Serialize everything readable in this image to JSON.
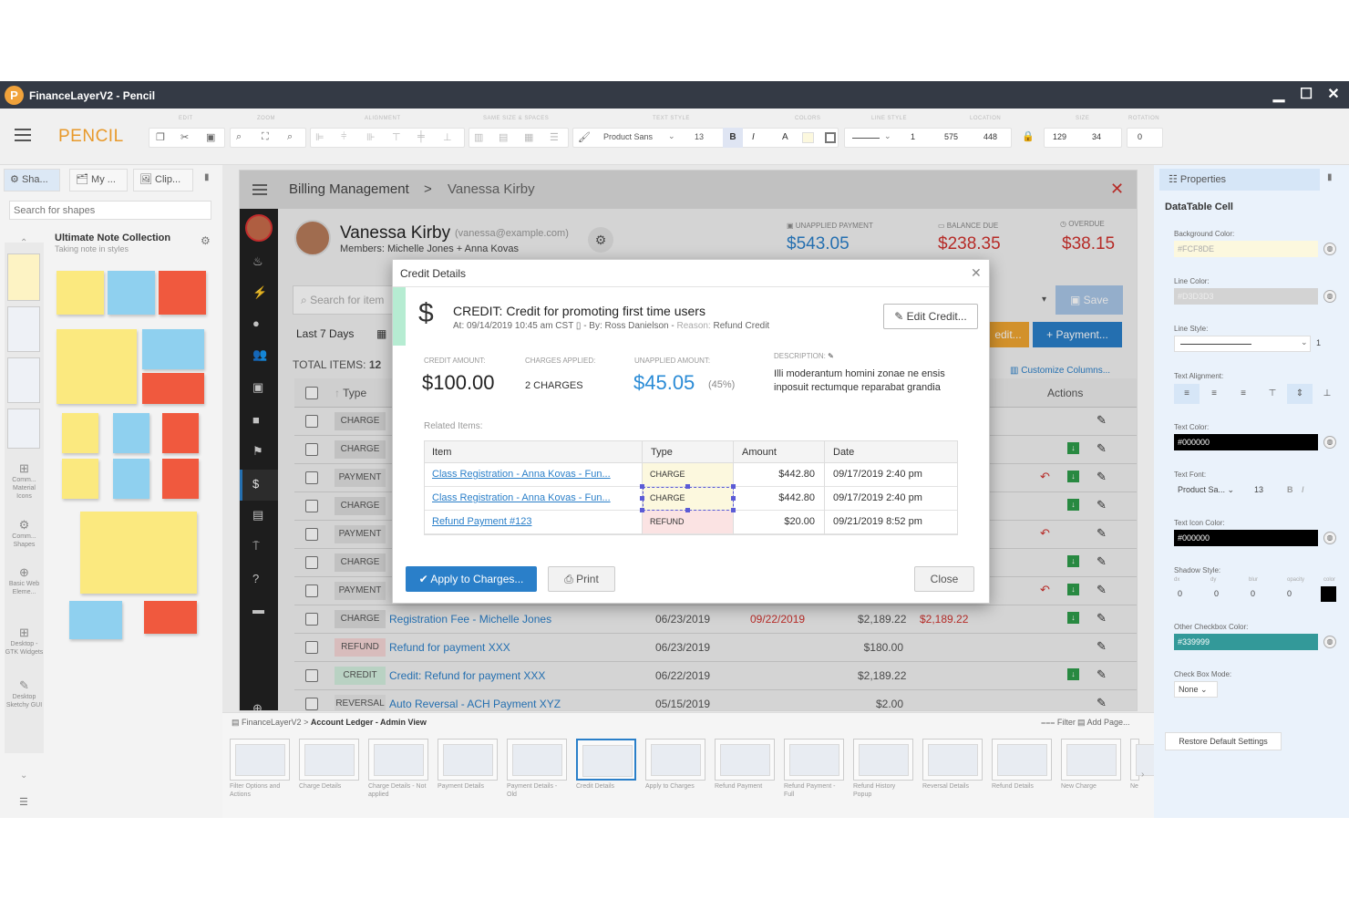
{
  "app": {
    "title": "FinanceLayerV2 - Pencil",
    "logo_letter": "P",
    "brand": "PENCIL",
    "brand_color": "#e8992a"
  },
  "window_controls": {
    "minimize": "▁",
    "maximize": "☐",
    "close": "✕"
  },
  "toolbar": {
    "section_labels": [
      "EDIT",
      "ZOOM",
      "ALIGNMENT",
      "SAME SIZE & SPACES",
      "TEXT STYLE",
      "COLORS",
      "LINE STYLE",
      "LOCATION",
      "SIZE",
      "ROTATION"
    ],
    "font_name": "Product Sans",
    "font_size": "13",
    "bold": "B",
    "italic": "I",
    "text_color": "A",
    "line_width": "1",
    "loc_x": "575",
    "loc_y": "448",
    "width": "129",
    "height": "34",
    "rotation": "0"
  },
  "left": {
    "tabs": [
      "Sha...",
      "My ...",
      "Clip..."
    ],
    "search_placeholder": "Search for shapes",
    "collection_title": "Ultimate Note Collection",
    "collection_subtitle": "Taking note in styles",
    "rail": [
      "Comm... Material Icons",
      "Comm... Shapes",
      "Basic Web Eleme...",
      "Desktop - GTK Widgets",
      "Desktop Sketchy GUI"
    ]
  },
  "page": {
    "breadcrumb_root": "Billing Management",
    "breadcrumb_sep": ">",
    "breadcrumb_leaf": "Vanessa Kirby",
    "customer": {
      "name": "Vanessa Kirby",
      "email": "(vanessa@example.com)",
      "members": "Members: Michelle Jones + Anna Kovas"
    },
    "stats": [
      {
        "label": "UNAPPLIED PAYMENT",
        "value": "$543.05",
        "color": "#2a7fc9"
      },
      {
        "label": "BALANCE DUE",
        "value": "$238.35",
        "color": "#d0312d"
      },
      {
        "label": "OVERDUE",
        "value": "$38.15",
        "color": "#d0312d"
      }
    ],
    "search_placeholder": "Search for item",
    "date_filter": "Last 7 Days",
    "total_items_label": "TOTAL ITEMS:",
    "total_items": "12",
    "save_label": "Save",
    "credit_label": "edit...",
    "payment_label": "+ Payment...",
    "customize_label": "Customize Columns...",
    "col_type": "Type",
    "col_actions": "Actions",
    "rows": [
      {
        "type": "CHARGE",
        "item": "",
        "date": "",
        "due": "",
        "amount": "",
        "balance": ""
      },
      {
        "type": "CHARGE",
        "item": "",
        "date": "",
        "due": "",
        "amount": "",
        "balance": ""
      },
      {
        "type": "PAYMENT",
        "item": "",
        "date": "",
        "due": "",
        "amount": "",
        "balance": ""
      },
      {
        "type": "CHARGE",
        "item": "",
        "date": "",
        "due": "",
        "amount": "",
        "balance": ""
      },
      {
        "type": "PAYMENT",
        "item": "",
        "date": "",
        "due": "",
        "amount": "",
        "balance": ""
      },
      {
        "type": "CHARGE",
        "item": "",
        "date": "",
        "due": "",
        "amount": "",
        "balance": ""
      },
      {
        "type": "PAYMENT",
        "item": "",
        "date": "",
        "due": "",
        "amount": "",
        "balance": ""
      },
      {
        "type": "CHARGE",
        "item": "Registration Fee - Michelle Jones",
        "date": "06/23/2019",
        "due": "09/22/2019",
        "amount": "$2,189.22",
        "balance": "$2,189.22"
      },
      {
        "type": "REFUND",
        "item": "Refund for payment XXX",
        "date": "06/23/2019",
        "due": "",
        "amount": "$180.00",
        "balance": ""
      },
      {
        "type": "CREDIT",
        "item": "Credit: Refund for payment XXX",
        "date": "06/22/2019",
        "due": "",
        "amount": "$2,189.22",
        "balance": ""
      },
      {
        "type": "REVERSAL",
        "item": "Auto Reversal - ACH Payment XYZ",
        "date": "05/15/2019",
        "due": "",
        "amount": "$2.00",
        "balance": ""
      }
    ]
  },
  "modal": {
    "title": "Credit Details",
    "heading": "CREDIT: Credit for promoting first time users",
    "meta": "At: 09/14/2019 10:45 am CST",
    "by": "- By: Ross Danielson -",
    "reason_label": "Reason:",
    "reason": "Refund Credit",
    "edit_label": "Edit Credit...",
    "credit_amount_label": "CREDIT AMOUNT:",
    "credit_amount": "$100.00",
    "charges_applied_label": "CHARGES APPLIED:",
    "charges_applied": "2 CHARGES",
    "unapplied_label": "UNAPPLIED AMOUNT:",
    "unapplied": "$45.05",
    "unapplied_pct": "(45%)",
    "description_label": "DESCRIPTION:",
    "description": "Illi moderantum homini zonae ne ensis inposuit rectumque reparabat grandia",
    "related_label": "Related Items:",
    "cols": [
      "Item",
      "Type",
      "Amount",
      "Date"
    ],
    "items": [
      {
        "item": "Class Registration - Anna Kovas - Fun...",
        "type": "CHARGE",
        "amount": "$442.80",
        "date": "09/17/2019 2:40 pm"
      },
      {
        "item": "Class Registration - Anna Kovas - Fun...",
        "type": "CHARGE",
        "amount": "$442.80",
        "date": "09/17/2019 2:40 pm"
      },
      {
        "item": "Refund Payment #123",
        "type": "REFUND",
        "amount": "$20.00",
        "date": "09/21/2019 8:52 pm"
      }
    ],
    "apply_label": "Apply to Charges...",
    "print_label": "Print",
    "close_label": "Close"
  },
  "filmstrip": {
    "path_root": "FinanceLayerV2",
    "path_leaf": "Account Ledger - Admin View",
    "filter_label": "Filter",
    "add_page_label": "Add Page...",
    "pages": [
      "Filter Options and Actions",
      "Charge Details",
      "Charge Details - Not applied",
      "Payment Details",
      "Payment Details - Old",
      "Credit Details",
      "Apply to Charges",
      "Refund Payment",
      "Refund Payment - Full",
      "Refund History Popup",
      "Reversal Details",
      "Refund Details",
      "New Charge",
      "Ne"
    ]
  },
  "right": {
    "tab": "Properties",
    "section": "DataTable Cell",
    "bg_label": "Background Color:",
    "bg_value": "#FCF8DE",
    "line_color_label": "Line Color:",
    "line_color_value": "#D3D3D3",
    "line_style_label": "Line Style:",
    "line_style_width": "1",
    "text_align_label": "Text Alignment:",
    "text_color_label": "Text Color:",
    "text_color_value": "#000000",
    "text_font_label": "Text Font:",
    "text_font_value": "Product Sa...",
    "text_font_size": "13",
    "text_icon_label": "Text Icon Color:",
    "text_icon_value": "#000000",
    "shadow_label": "Shadow Style:",
    "shadow_cols": [
      "dx",
      "dy",
      "blur",
      "opacity",
      "color"
    ],
    "shadow_vals": [
      "0",
      "0",
      "0",
      "0"
    ],
    "checkbox_color_label": "Other Checkbox Color:",
    "checkbox_color_value": "#339999",
    "checkbox_mode_label": "Check Box Mode:",
    "checkbox_mode_value": "None",
    "restore_label": "Restore Default Settings"
  }
}
